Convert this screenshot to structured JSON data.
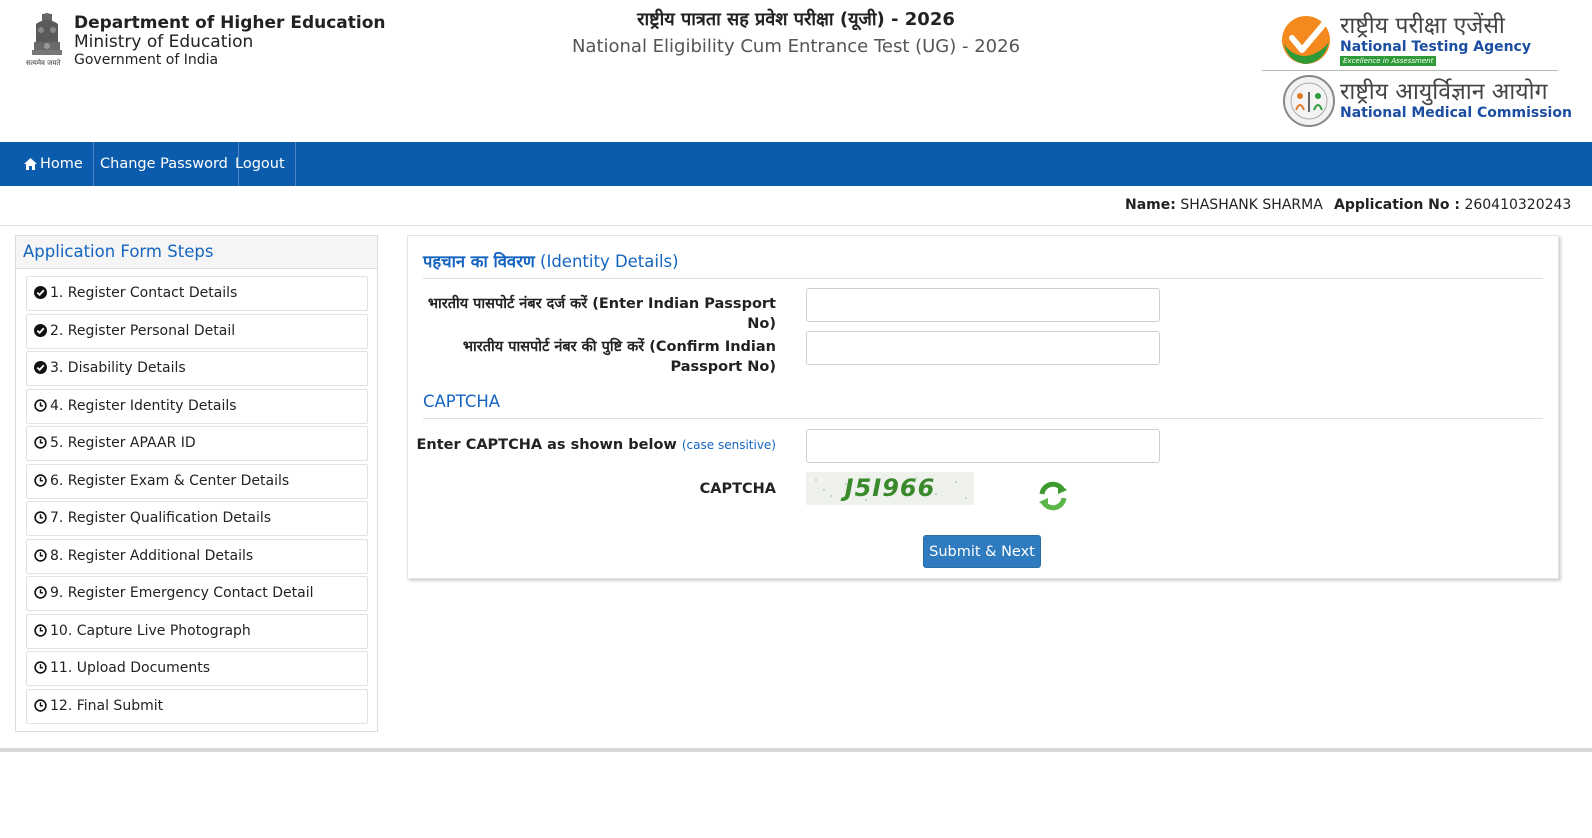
{
  "header": {
    "emblem_caption": "सत्यमेव जयते",
    "dept_line1": "Department of Higher Education",
    "dept_line2": "Ministry of Education",
    "dept_line3": "Government of India",
    "title_hindi": "राष्ट्रीय पात्रता सह प्रवेश परीक्षा (यूजी) - 2026",
    "title_english": "National Eligibility Cum Entrance Test (UG) - 2026",
    "nta_hindi": "राष्ट्रीय परीक्षा एजेंसी",
    "nta_english": "National Testing Agency",
    "nta_tagline": "Excellence in Assessment",
    "nmc_hindi": "राष्ट्रीय आयुर्विज्ञान आयोग",
    "nmc_english": "National Medical Commission"
  },
  "nav": {
    "home": "Home",
    "change_password": "Change Password",
    "logout": "Logout"
  },
  "user": {
    "name_label": "Name:",
    "name_value": "SHASHANK SHARMA",
    "app_label": "Application No :",
    "app_value": "260410320243"
  },
  "sidebar": {
    "title": "Application Form Steps",
    "steps": [
      {
        "label": "1. Register Contact Details",
        "status": "completed",
        "icon": "check-circle-icon"
      },
      {
        "label": "2. Register Personal Detail",
        "status": "completed",
        "icon": "check-circle-icon"
      },
      {
        "label": "3. Disability Details",
        "status": "completed",
        "icon": "check-circle-icon"
      },
      {
        "label": "4. Register Identity Details",
        "status": "pending",
        "icon": "clock-icon"
      },
      {
        "label": "5. Register APAAR ID",
        "status": "pending",
        "icon": "clock-icon"
      },
      {
        "label": "6. Register Exam & Center Details",
        "status": "pending",
        "icon": "clock-icon"
      },
      {
        "label": "7. Register Qualification Details",
        "status": "pending",
        "icon": "clock-icon"
      },
      {
        "label": "8. Register Additional Details",
        "status": "pending",
        "icon": "clock-icon"
      },
      {
        "label": "9. Register Emergency Contact Detail",
        "status": "pending",
        "icon": "clock-icon"
      },
      {
        "label": "10. Capture Live Photograph",
        "status": "pending",
        "icon": "clock-icon"
      },
      {
        "label": "11. Upload Documents",
        "status": "pending",
        "icon": "clock-icon"
      },
      {
        "label": "12. Final Submit",
        "status": "pending",
        "icon": "clock-icon"
      }
    ]
  },
  "form": {
    "section_title_hindi": "पहचान का विवरण",
    "section_title_english": "(Identity Details)",
    "passport_label": "भारतीय पासपोर्ट नंबर दर्ज करें (Enter Indian Passport No)",
    "passport_value": "",
    "confirm_label": "भारतीय पासपोर्ट नंबर की पुष्टि करें (Confirm Indian Passport No)",
    "confirm_value": "",
    "captcha_section": "CAPTCHA",
    "captcha_label": "Enter CAPTCHA as shown below",
    "captcha_hint": "(case sensitive)",
    "captcha_value": "",
    "captcha_image_label": "CAPTCHA",
    "captcha_text": "J5I966",
    "submit": "Submit & Next"
  },
  "colors": {
    "nav_bg": "#0b5cad",
    "accent": "#1565c0",
    "submit_bg": "#2f7bbf"
  }
}
